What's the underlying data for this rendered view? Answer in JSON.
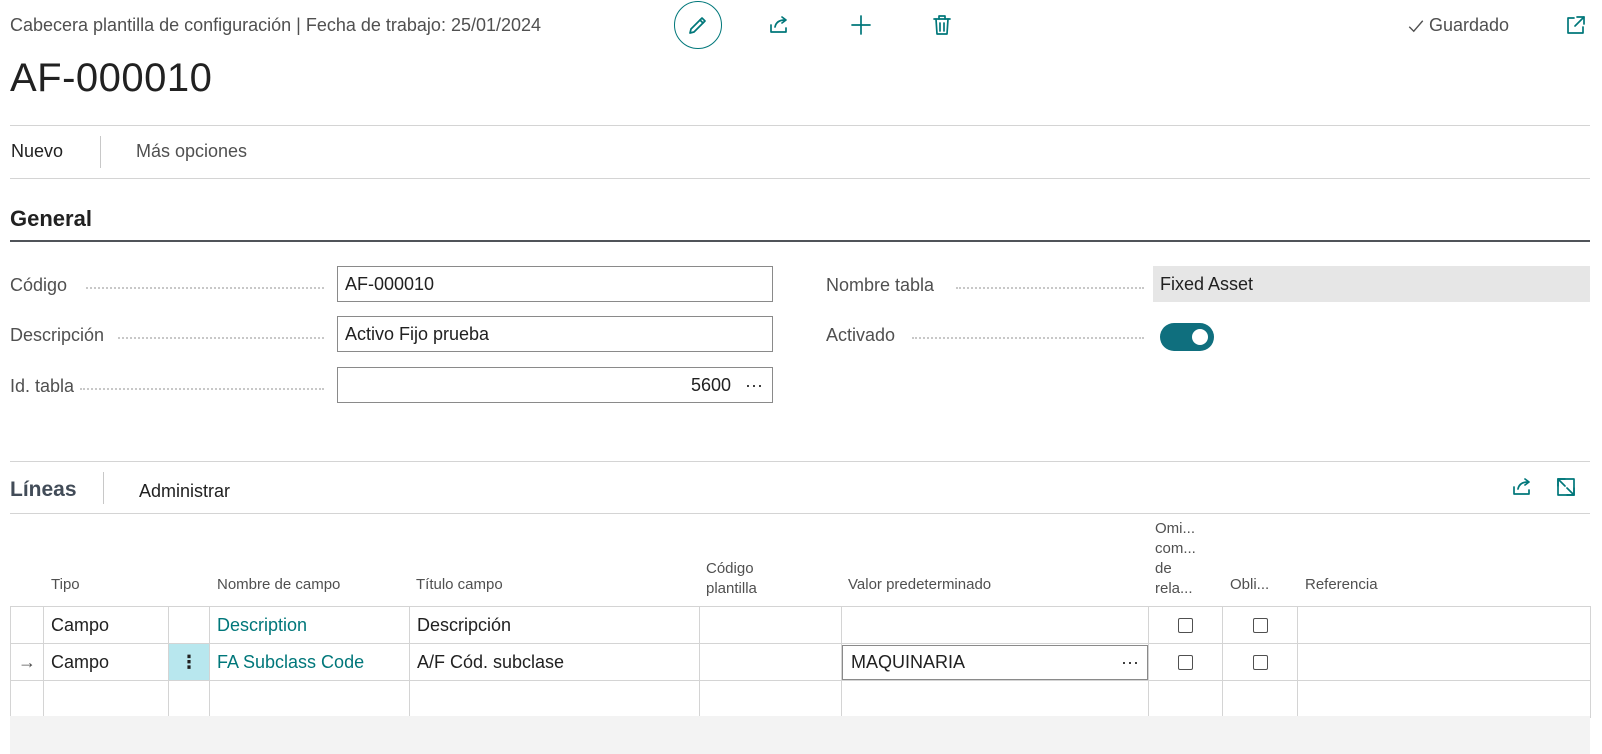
{
  "header": {
    "breadcrumb": "Cabecera plantilla de configuración | Fecha de trabajo: 25/01/2024",
    "title": "AF-000010",
    "saved_label": "Guardado",
    "icons": [
      "pencil-icon",
      "share-icon",
      "plus-icon",
      "trash-icon",
      "check-icon",
      "open-new-window-icon"
    ]
  },
  "actions": {
    "new_label": "Nuevo",
    "more_label": "Más opciones"
  },
  "general": {
    "heading": "General",
    "code_label": "Código",
    "code_value": "AF-000010",
    "description_label": "Descripción",
    "description_value": "Activo Fijo prueba",
    "table_id_label": "Id. tabla",
    "table_id_value": "5600",
    "lookup_glyph": "···",
    "table_name_label": "Nombre tabla",
    "table_name_value": "Fixed Asset",
    "enabled_label": "Activado",
    "enabled_value": true
  },
  "lines": {
    "title": "Líneas",
    "manage_label": "Administrar",
    "columns": {
      "type": "Tipo",
      "field_name": "Nombre de campo",
      "field_caption": "Título campo",
      "template_code_1": "Código",
      "template_code_2": "plantilla",
      "default_value": "Valor predeterminado",
      "skip_1": "Omi...",
      "skip_2": "com...",
      "skip_3": "de",
      "skip_4": "rela...",
      "mandatory": "Obli...",
      "reference": "Referencia"
    },
    "rows": [
      {
        "type": "Campo",
        "field_name": "Description",
        "field_caption": "Descripción",
        "template_code": "",
        "default_value": "",
        "skip": false,
        "mandatory": false,
        "reference": ""
      },
      {
        "type": "Campo",
        "field_name": "FA Subclass Code",
        "field_caption": "A/F Cód. subclase",
        "template_code": "",
        "default_value": "MAQUINARIA",
        "skip": false,
        "mandatory": false,
        "reference": "",
        "selected": true,
        "row_arrow": "→",
        "menu_glyph": "⋮"
      }
    ]
  },
  "colors": {
    "accent": "#00777a",
    "toggle_on": "#0f6f7e",
    "selected_cell": "#b8e7ee"
  }
}
